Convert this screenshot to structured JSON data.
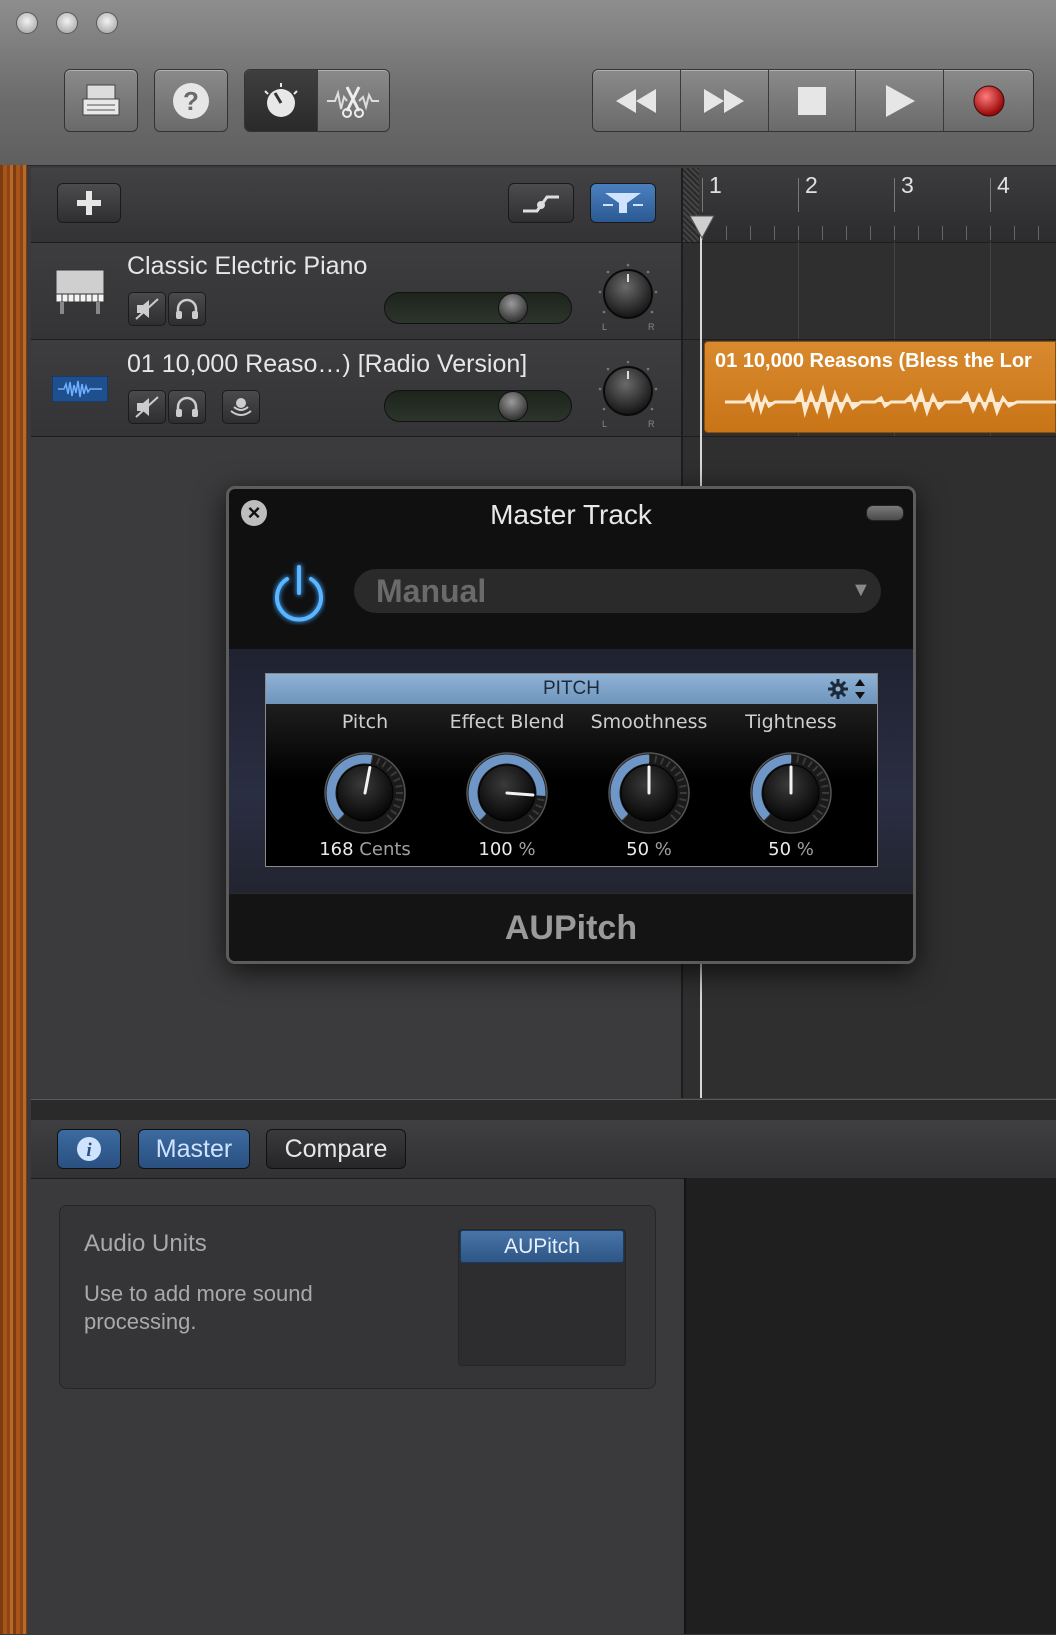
{
  "toolbar": {
    "window_controls": [
      "close-button",
      "minimize-button",
      "zoom-button"
    ],
    "left_buttons": [
      {
        "name": "library-button",
        "icon": "drawer-icon"
      },
      {
        "name": "help-button",
        "icon": "question-icon"
      }
    ],
    "view_buttons": [
      {
        "name": "smart-controls-button",
        "icon": "knob-icon",
        "active": true
      },
      {
        "name": "editors-button",
        "icon": "scissors-icon",
        "active": false
      }
    ],
    "transport": [
      {
        "name": "rewind-button",
        "icon": "rewind-icon"
      },
      {
        "name": "fast-forward-button",
        "icon": "fast-forward-icon"
      },
      {
        "name": "stop-button",
        "icon": "stop-icon"
      },
      {
        "name": "play-button",
        "icon": "play-icon"
      },
      {
        "name": "record-button",
        "icon": "record-icon"
      }
    ]
  },
  "tracks_header": {
    "add_icon": "plus-icon",
    "automation_icon": "automation-icon",
    "master_icon": "master-track-icon"
  },
  "tracks": [
    {
      "name": "Classic Electric Piano",
      "icon": "piano-icon",
      "volume": 0.68,
      "pan": 0
    },
    {
      "name": "01 10,000 Reaso…) [Radio Version]",
      "icon": "waveform-icon",
      "volume": 0.68,
      "pan": 0
    }
  ],
  "ruler": {
    "bars": [
      "1",
      "2",
      "3",
      "4"
    ]
  },
  "region": {
    "title": "01 10,000 Reasons (Bless the Lor",
    "color": "#d98a2e"
  },
  "plugin": {
    "title": "Master Track",
    "preset": "Manual",
    "section": "PITCH",
    "name": "AUPitch",
    "params": [
      {
        "label": "Pitch",
        "value": "168",
        "unit": "Cents",
        "level": 0.54
      },
      {
        "label": "Effect Blend",
        "value": "100",
        "unit": "%",
        "level": 0.85
      },
      {
        "label": "Smoothness",
        "value": "50",
        "unit": "%",
        "level": 0.5
      },
      {
        "label": "Tightness",
        "value": "50",
        "unit": "%",
        "level": 0.5
      }
    ]
  },
  "editor": {
    "info_icon": "info-icon",
    "tabs": [
      {
        "label": "Master",
        "active": true
      },
      {
        "label": "Compare",
        "active": false
      }
    ],
    "audio_units_title": "Audio Units",
    "audio_units_desc": "Use to add more sound processing.",
    "slot": "AUPitch"
  },
  "colors": {
    "accent": "#2f5a8c",
    "region": "#d98a2e",
    "record": "#c81e1e"
  }
}
